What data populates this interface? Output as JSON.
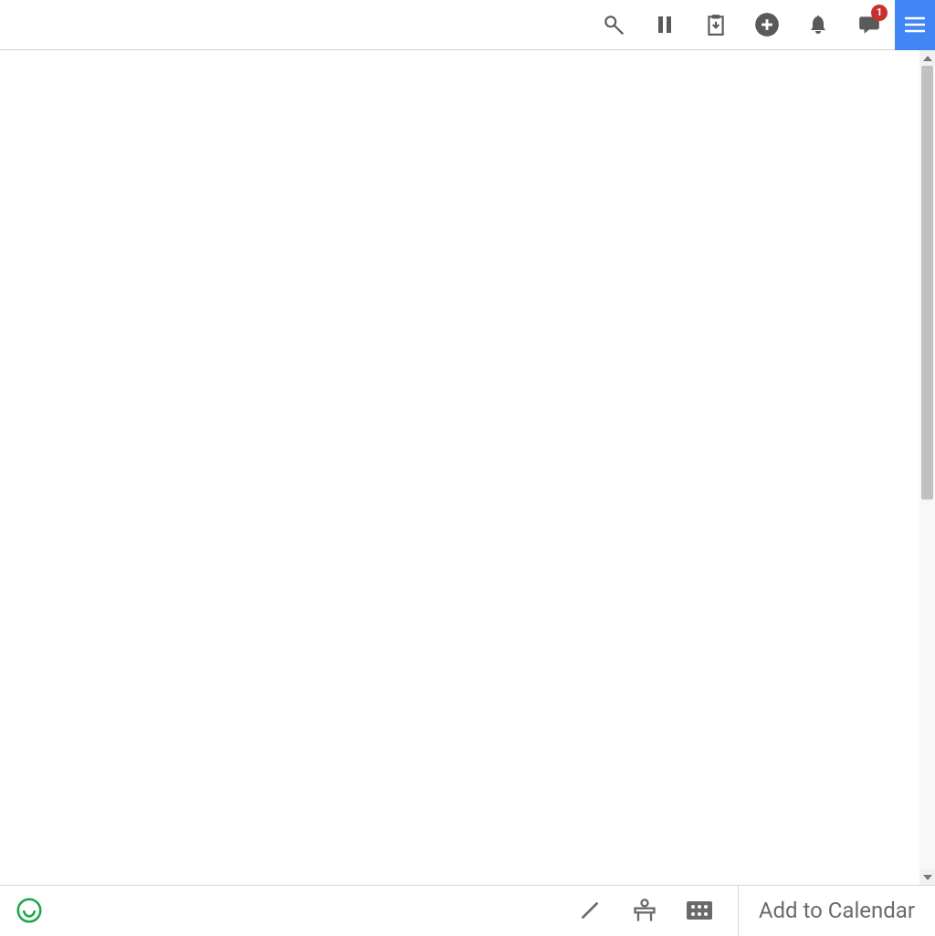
{
  "toolbar": {
    "search_icon": "search",
    "pause_icon": "pause",
    "clipboard_icon": "clipboard",
    "add_icon": "add",
    "bell_icon": "notifications",
    "chat_icon": "chat",
    "chat_badge": "1",
    "menu_icon": "menu"
  },
  "bottom": {
    "smile_icon": "smile",
    "edit_icon": "edit",
    "occupancy_icon": "occupancy",
    "grid_icon": "grid",
    "calendar_button": "Add to Calendar"
  },
  "colors": {
    "accent": "#4285f4",
    "badge": "#c93131",
    "icon_gray": "#5a5a5a",
    "success": "#1ba84a"
  }
}
